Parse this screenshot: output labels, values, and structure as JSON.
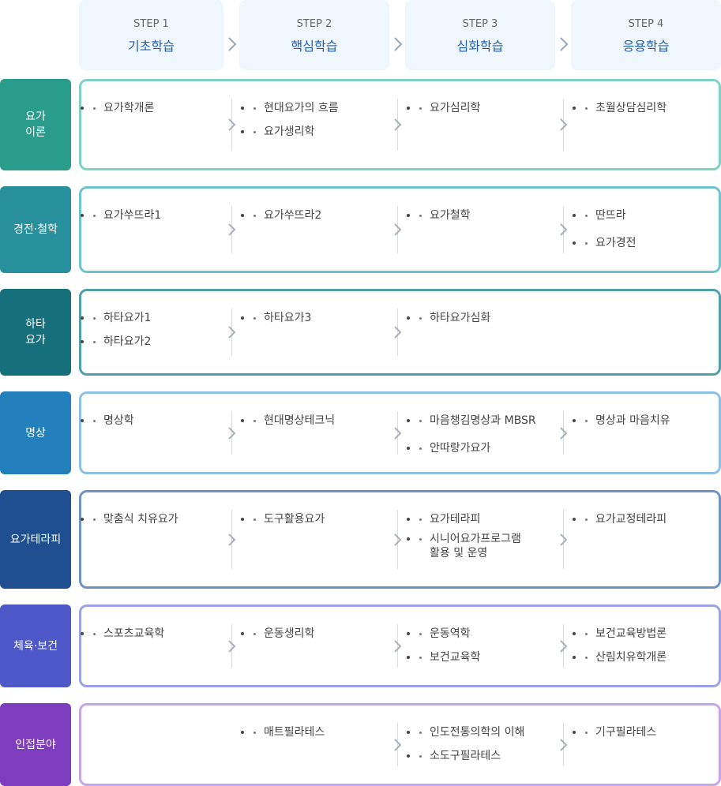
{
  "steps": [
    {
      "num": "STEP 1",
      "name": "기초학습"
    },
    {
      "num": "STEP 2",
      "name": "핵심학습"
    },
    {
      "num": "STEP 3",
      "name": "심화학습"
    },
    {
      "num": "STEP 4",
      "name": "응용학습"
    }
  ],
  "rows": [
    {
      "label": "요가\n이론",
      "color": "#2a9c8c",
      "border": "#7fd1c4",
      "cols": [
        [
          "요가학개론"
        ],
        [
          "현대요가의 흐름",
          "요가생리학"
        ],
        [
          "요가심리학"
        ],
        [
          "초월상담심리학"
        ]
      ]
    },
    {
      "label": "경전·철학",
      "color": "#27909c",
      "border": "#6dc4cf",
      "cols": [
        [
          "요가쑤뜨라1"
        ],
        [
          "요가쑤뜨라2"
        ],
        [
          "요가철학"
        ],
        [
          "딴뜨라",
          "요가경전"
        ]
      ]
    },
    {
      "label": "하타\n요가",
      "color": "#15707c",
      "border": "#4f9fad",
      "cols": [
        [
          "하타요가1",
          "하타요가2"
        ],
        [
          "하타요가3"
        ],
        [
          "하타요가심화"
        ],
        []
      ]
    },
    {
      "label": "명상",
      "color": "#2380bd",
      "border": "#8cc0e6",
      "cols": [
        [
          "명상학"
        ],
        [
          "현대명상테크닉"
        ],
        [
          "마음챙김명상과 MBSR",
          "안따랑가요가"
        ],
        [
          "명상과 마음치유"
        ]
      ]
    },
    {
      "label": "요가테라피",
      "color": "#1f4f90",
      "border": "#6f93c4",
      "cols": [
        [
          "맞춤식 치유요가"
        ],
        [
          "도구활용요가"
        ],
        [
          "요가테라피",
          "시니어요가프로그램\n활용 및 운영"
        ],
        [
          "요가교정테라피"
        ]
      ]
    },
    {
      "label": "체육·보건",
      "color": "#4e58c8",
      "border": "#9ba3e4",
      "cols": [
        [
          "스포츠교육학"
        ],
        [
          "운동생리학"
        ],
        [
          "운동역학",
          "보건교육학"
        ],
        [
          "보건교육방법론",
          "산림치유학개론"
        ]
      ]
    },
    {
      "label": "인접분야",
      "color": "#7e3cbf",
      "border": "#c7a4e6",
      "cols": [
        [],
        [
          "매트필라테스"
        ],
        [
          "인도전통의학의 이해",
          "소도구필라테스"
        ],
        [
          "기구필라테스"
        ]
      ]
    }
  ]
}
